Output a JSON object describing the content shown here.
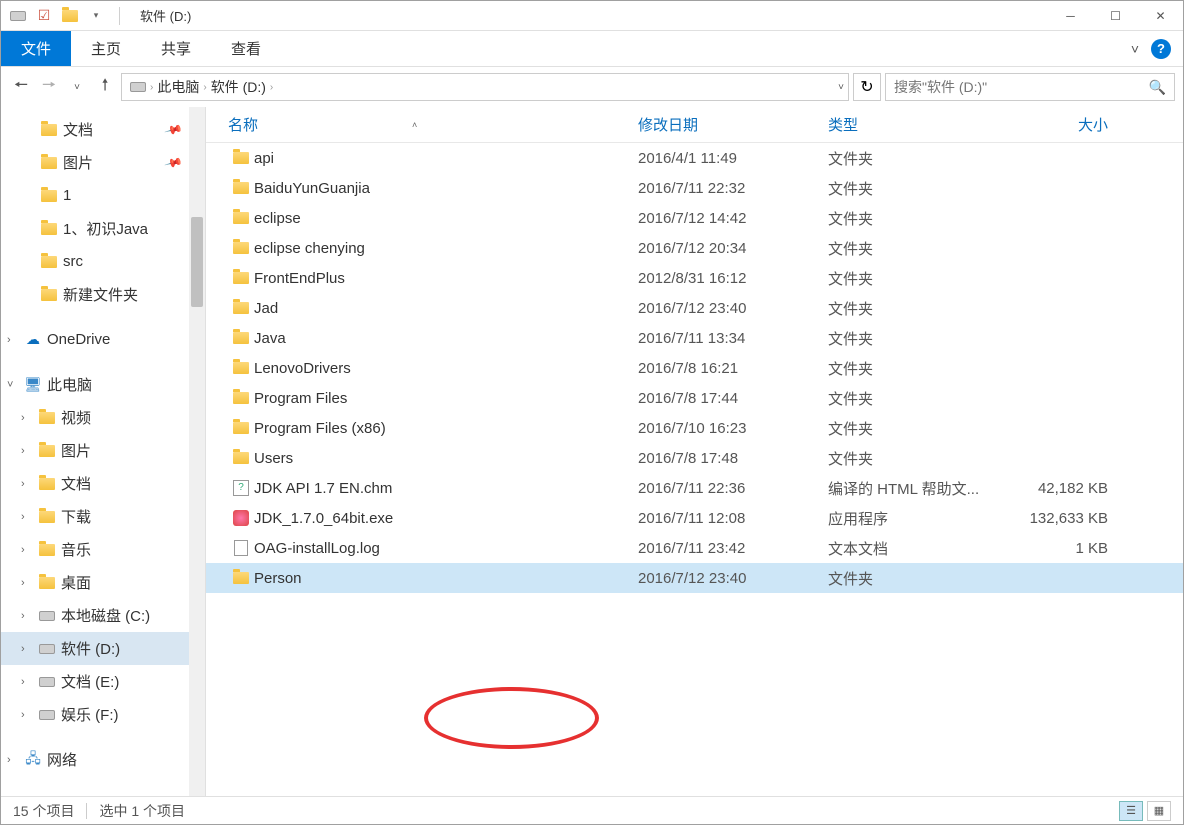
{
  "window": {
    "title": "软件 (D:)"
  },
  "ribbon": {
    "file": "文件",
    "tabs": [
      "主页",
      "共享",
      "查看"
    ]
  },
  "breadcrumbs": [
    "此电脑",
    "软件 (D:)"
  ],
  "search": {
    "placeholder": "搜索\"软件 (D:)\""
  },
  "sidebar": {
    "quick": [
      {
        "label": "文档",
        "pinned": true
      },
      {
        "label": "图片",
        "pinned": true
      },
      {
        "label": "1"
      },
      {
        "label": "1、初识Java"
      },
      {
        "label": "src"
      },
      {
        "label": "新建文件夹"
      }
    ],
    "onedrive": "OneDrive",
    "thispc": {
      "label": "此电脑",
      "children": [
        "视频",
        "图片",
        "文档",
        "下载",
        "音乐",
        "桌面",
        "本地磁盘 (C:)",
        "软件 (D:)",
        "文档 (E:)",
        "娱乐 (F:)"
      ]
    },
    "network": "网络"
  },
  "columns": {
    "name": "名称",
    "date": "修改日期",
    "type": "类型",
    "size": "大小"
  },
  "files": [
    {
      "name": "api",
      "date": "2016/4/1 11:49",
      "type": "文件夹",
      "size": "",
      "icon": "folder"
    },
    {
      "name": "BaiduYunGuanjia",
      "date": "2016/7/11 22:32",
      "type": "文件夹",
      "size": "",
      "icon": "folder"
    },
    {
      "name": "eclipse",
      "date": "2016/7/12 14:42",
      "type": "文件夹",
      "size": "",
      "icon": "folder"
    },
    {
      "name": "eclipse chenying",
      "date": "2016/7/12 20:34",
      "type": "文件夹",
      "size": "",
      "icon": "folder"
    },
    {
      "name": "FrontEndPlus",
      "date": "2012/8/31 16:12",
      "type": "文件夹",
      "size": "",
      "icon": "folder"
    },
    {
      "name": "Jad",
      "date": "2016/7/12 23:40",
      "type": "文件夹",
      "size": "",
      "icon": "folder"
    },
    {
      "name": "Java",
      "date": "2016/7/11 13:34",
      "type": "文件夹",
      "size": "",
      "icon": "folder"
    },
    {
      "name": "LenovoDrivers",
      "date": "2016/7/8 16:21",
      "type": "文件夹",
      "size": "",
      "icon": "folder"
    },
    {
      "name": "Program Files",
      "date": "2016/7/8 17:44",
      "type": "文件夹",
      "size": "",
      "icon": "folder"
    },
    {
      "name": "Program Files (x86)",
      "date": "2016/7/10 16:23",
      "type": "文件夹",
      "size": "",
      "icon": "folder"
    },
    {
      "name": "Users",
      "date": "2016/7/8 17:48",
      "type": "文件夹",
      "size": "",
      "icon": "folder"
    },
    {
      "name": "JDK API 1.7    EN.chm",
      "date": "2016/7/11 22:36",
      "type": "编译的 HTML 帮助文...",
      "size": "42,182 KB",
      "icon": "chm"
    },
    {
      "name": "JDK_1.7.0_64bit.exe",
      "date": "2016/7/11 12:08",
      "type": "应用程序",
      "size": "132,633 KB",
      "icon": "exe"
    },
    {
      "name": "OAG-installLog.log",
      "date": "2016/7/11 23:42",
      "type": "文本文档",
      "size": "1 KB",
      "icon": "log"
    },
    {
      "name": "Person",
      "date": "2016/7/12 23:40",
      "type": "文件夹",
      "size": "",
      "icon": "folder",
      "selected": true
    }
  ],
  "status": {
    "count": "15 个项目",
    "selection": "选中 1 个项目"
  }
}
